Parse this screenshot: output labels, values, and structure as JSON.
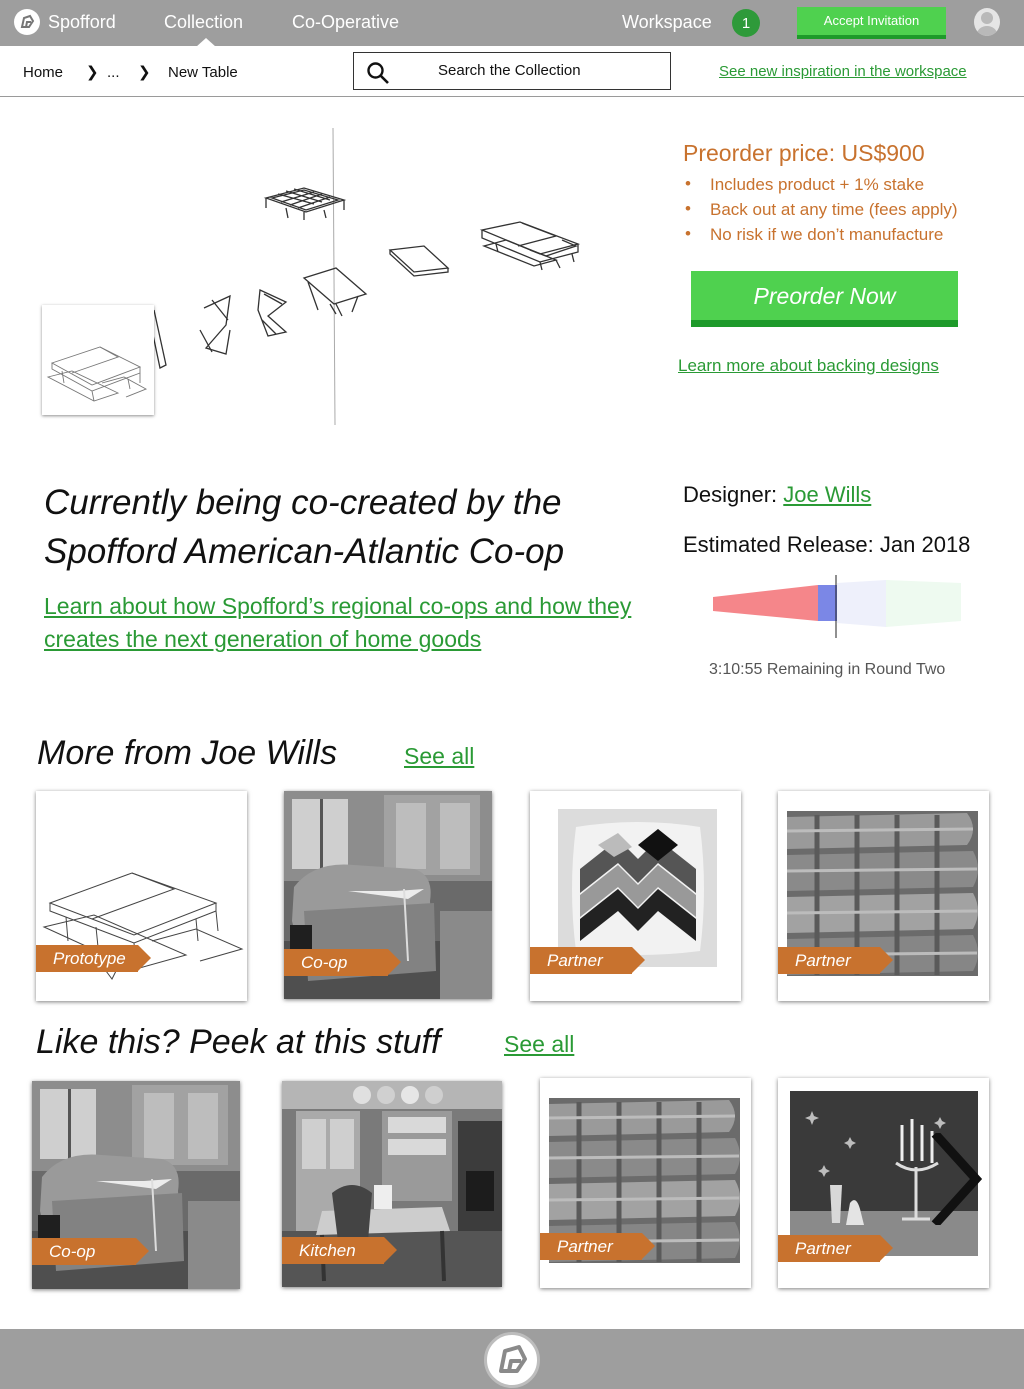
{
  "nav": {
    "brand": "Spofford",
    "collection": "Collection",
    "coop": "Co-Operative",
    "workspace": "Workspace",
    "workspace_count": "1",
    "accept_invitation": "Accept Invitation"
  },
  "breadcrumb": {
    "home": "Home",
    "ellipsis": "...",
    "current": "New Table"
  },
  "search": {
    "placeholder": "Search the Collection"
  },
  "inspiration_link": "See new inspiration in the workspace",
  "preorder": {
    "title": "Preorder price: US$900",
    "bullets": [
      "Includes product + 1% stake",
      "Back out at any time (fees apply)",
      "No risk if we don’t manufacture"
    ],
    "button": "Preorder Now",
    "learn_link": "Learn more about backing designs"
  },
  "coop": {
    "heading": "Currently being co-created by the Spofford American-Atlantic Co-op",
    "link": "Learn about how Spofford’s regional co-ops and how they creates the next generation of home goods"
  },
  "designer": {
    "label": "Designer:",
    "name": "Joe Wills",
    "release_label": "Estimated Release:",
    "release_date": "Jan 2018",
    "remaining": "3:10:55 Remaining in Round Two"
  },
  "more_from": {
    "title": "More from Joe Wills",
    "see_all": "See all",
    "items": [
      {
        "tag": "Prototype",
        "image": "table-sketch"
      },
      {
        "tag": "Co-op",
        "image": "armchair-photo"
      },
      {
        "tag": "Partner",
        "image": "chevron-pillow"
      },
      {
        "tag": "Partner",
        "image": "folded-blankets"
      }
    ]
  },
  "like_this": {
    "title": "Like this? Peek at this stuff",
    "see_all": "See all",
    "items": [
      {
        "tag": "Co-op",
        "image": "armchair-photo"
      },
      {
        "tag": "Kitchen",
        "image": "kitchen-photo"
      },
      {
        "tag": "Partner",
        "image": "folded-blankets"
      },
      {
        "tag": "Partner",
        "image": "candelabra-photo"
      }
    ]
  },
  "colors": {
    "nav_gray": "#9e9e9e",
    "accent_green": "#4fd14f",
    "link_green": "#2a9a35",
    "accent_orange": "#c8722e",
    "timeline_past": "#f5868a",
    "timeline_current": "#7b87e6",
    "timeline_next": "#eef0fb",
    "timeline_future": "#eefaf0"
  }
}
